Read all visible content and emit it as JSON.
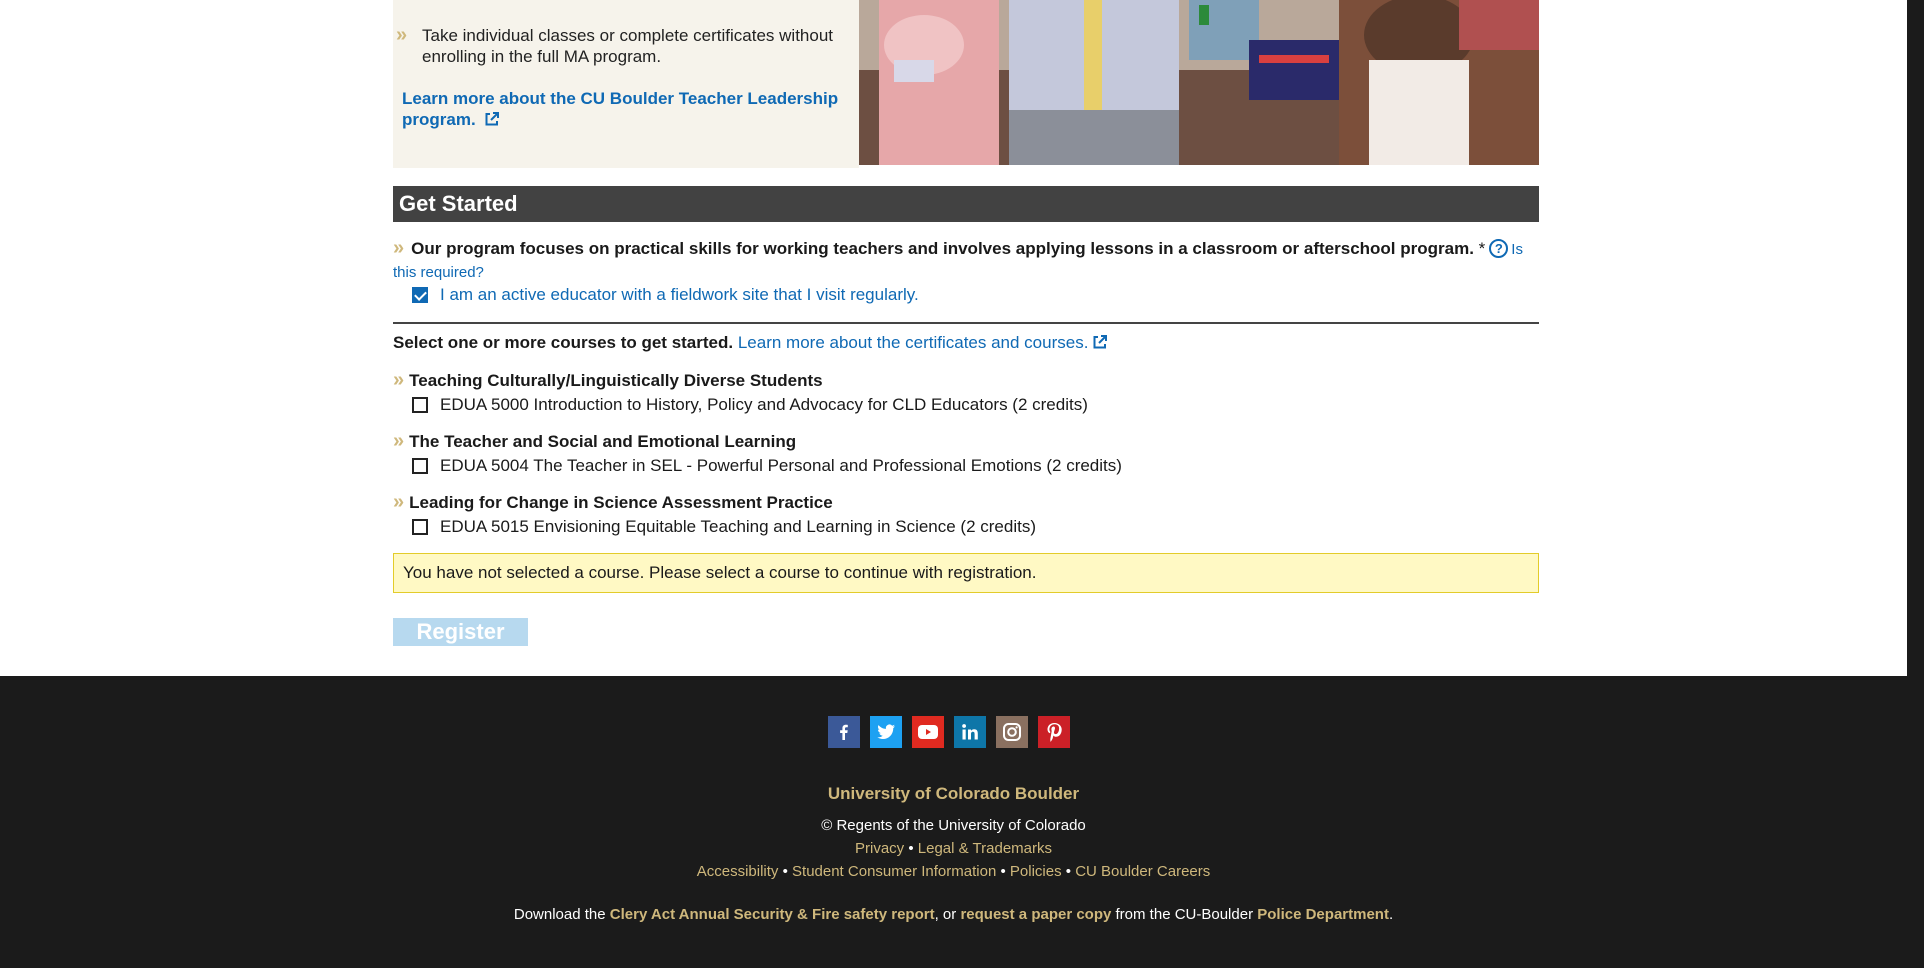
{
  "intro": {
    "bullet_text": "Take individual classes or complete certificates without enrolling in the full MA program.",
    "learn_more_link": "Learn more about the CU Boulder Teacher Leadership program."
  },
  "get_started": {
    "heading": "Get Started",
    "question_text": "Our program focuses on practical skills for working teachers and involves applying lessons in a classroom or afterschool program.",
    "required_marker": "*",
    "help_link": "Is this required?",
    "educator_checkbox": {
      "label": "I am an active educator with a fieldwork site that I visit regularly.",
      "checked": true
    }
  },
  "courses_section": {
    "prompt": "Select one or more courses to get started.",
    "learn_more_link": "Learn more about the certificates and courses.",
    "groups": [
      {
        "title": "Teaching Culturally/Linguistically Diverse Students",
        "course": "EDUA 5000 Introduction to History, Policy and Advocacy for CLD Educators (2 credits)",
        "checked": false
      },
      {
        "title": "The Teacher and Social and Emotional Learning",
        "course": "EDUA 5004 The Teacher in SEL - Powerful Personal and Professional Emotions (2 credits)",
        "checked": false
      },
      {
        "title": "Leading for Change in Science Assessment Practice",
        "course": "EDUA 5015 Envisioning Equitable Teaching and Learning in Science (2 credits)",
        "checked": false
      }
    ],
    "alert": "You have not selected a course. Please select a course to continue with registration.",
    "register_button": "Register"
  },
  "footer": {
    "social_icons": [
      "facebook-icon",
      "twitter-icon",
      "youtube-icon",
      "linkedin-icon",
      "instagram-icon",
      "pinterest-icon"
    ],
    "university": "University of Colorado Boulder",
    "copyright": "© Regents of the University of Colorado",
    "links_row1": [
      "Privacy",
      "Legal & Trademarks"
    ],
    "links_row2": [
      "Accessibility",
      "Student Consumer Information",
      "Policies",
      "CU Boulder Careers"
    ],
    "separator": "•",
    "clery": {
      "prefix": "Download the",
      "report_link": "Clery Act Annual Security & Fire safety report",
      "middle": ", or",
      "paper_link": "request a paper copy",
      "suffix": "from the CU-Boulder",
      "police_link": "Police Department",
      "end": "."
    }
  },
  "colors": {
    "link_blue": "#0f69b4",
    "gold": "#cfb87c",
    "heading_bar": "#424242",
    "footer_bg": "#1b1b1b",
    "alert_bg": "#fff9c4"
  }
}
